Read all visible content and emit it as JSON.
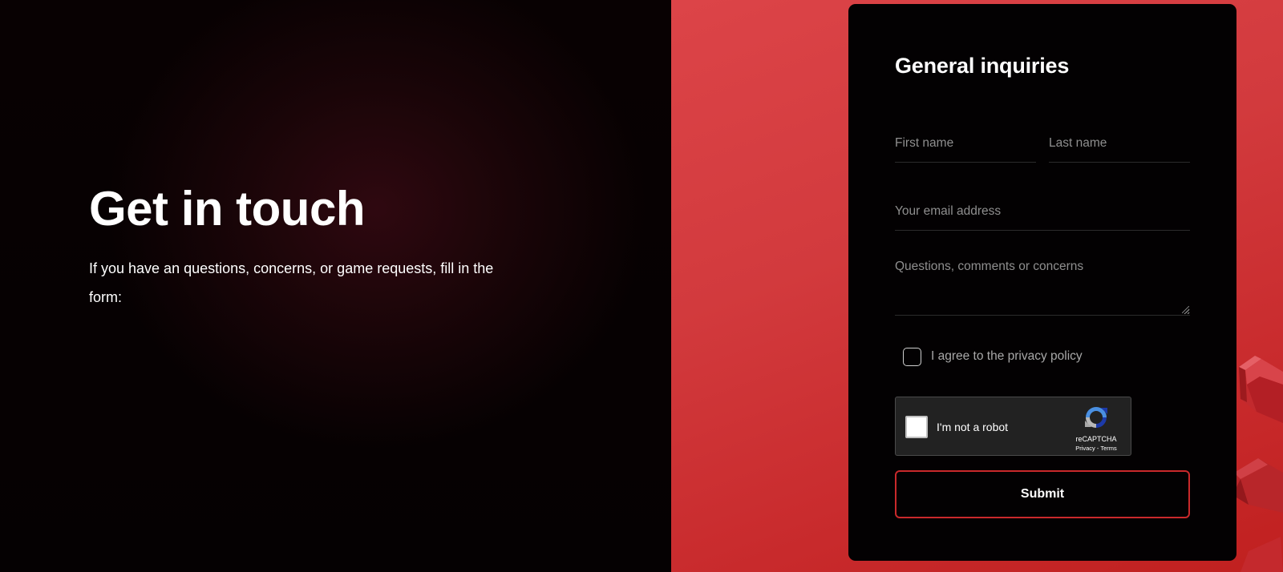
{
  "hero": {
    "title": "Get in touch",
    "description": "If you have an questions, concerns, or game requests, fill in the form:"
  },
  "form": {
    "title": "General inquiries",
    "first_name_placeholder": "First name",
    "last_name_placeholder": "Last name",
    "email_placeholder": "Your email address",
    "message_placeholder": "Questions, comments or concerns",
    "agree_label": "I agree to the privacy policy",
    "agree_checked": false,
    "submit_label": "Submit"
  },
  "recaptcha": {
    "label": "I'm not a robot",
    "brand": "reCAPTCHA",
    "terms": "Privacy - Terms"
  },
  "colors": {
    "accent": "#c9292b",
    "right_panel": "#d23a3d",
    "card_bg": "#030102"
  },
  "icons": {
    "recaptcha_logo": "recaptcha-logo-icon",
    "textarea_resize": "resize-grip-icon"
  }
}
